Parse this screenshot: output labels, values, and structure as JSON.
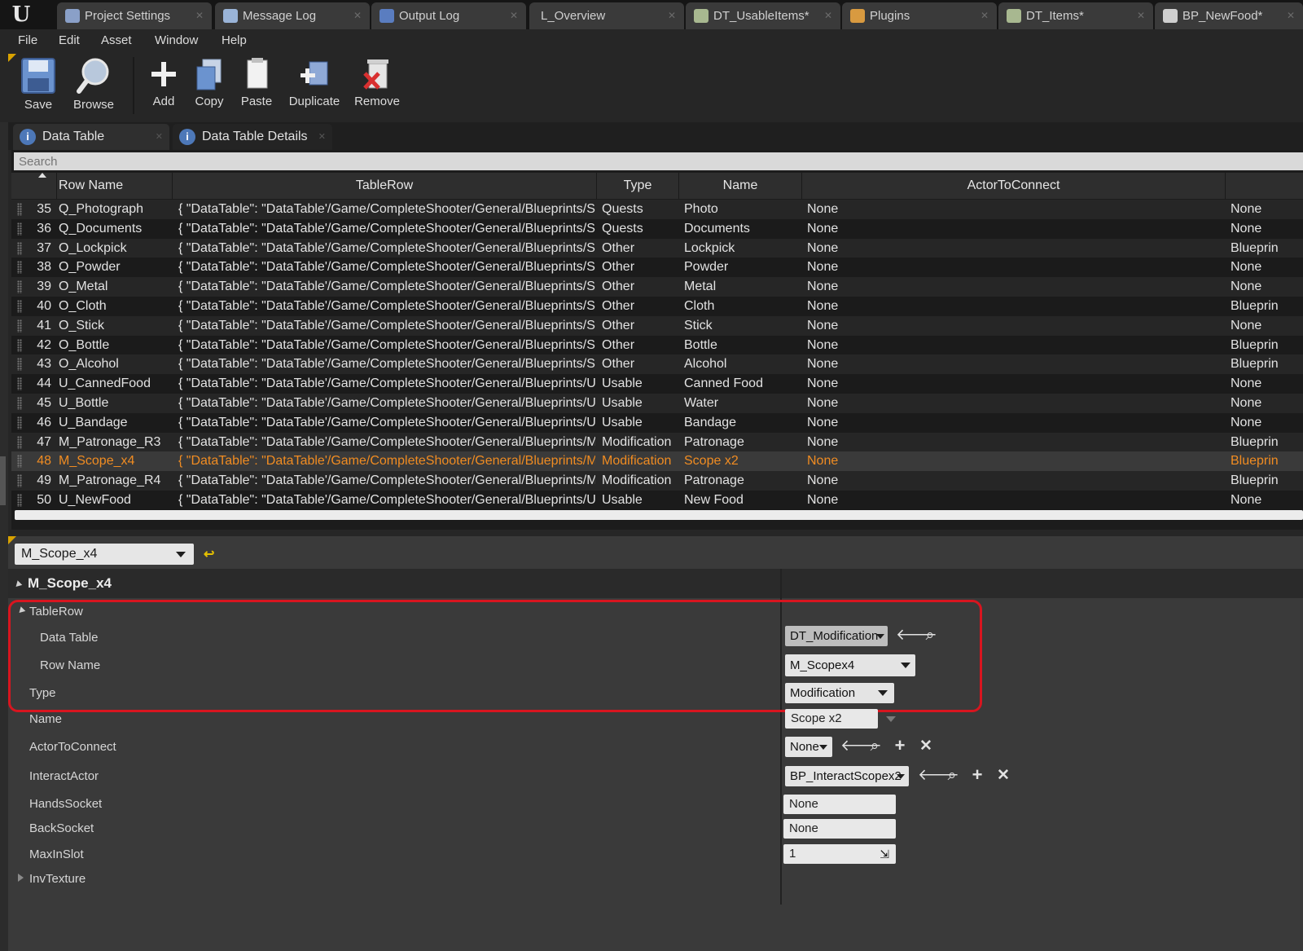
{
  "tabs": [
    {
      "label": "Project Settings",
      "icon": "gear-icon",
      "color": "#8aa0c8"
    },
    {
      "label": "Message Log",
      "icon": "message-log-icon",
      "color": "#9ab4d8"
    },
    {
      "label": "Output Log",
      "icon": "output-log-icon",
      "color": "#5a7dc0"
    },
    {
      "label": "L_Overview",
      "icon": "",
      "color": ""
    },
    {
      "label": "DT_UsableItems*",
      "icon": "data-table-icon",
      "color": "#a8b890"
    },
    {
      "label": "Plugins",
      "icon": "plugin-icon",
      "color": "#d89a40"
    },
    {
      "label": "DT_Items*",
      "icon": "data-table-icon",
      "color": "#a8b890"
    },
    {
      "label": "BP_NewFood*",
      "icon": "blueprint-icon",
      "color": "#cfcfcf"
    }
  ],
  "menu": [
    "File",
    "Edit",
    "Asset",
    "Window",
    "Help"
  ],
  "toolbar": {
    "save": "Save",
    "browse": "Browse",
    "add": "Add",
    "copy": "Copy",
    "paste": "Paste",
    "duplicate": "Duplicate",
    "remove": "Remove"
  },
  "panel_tabs": {
    "data_table": "Data Table",
    "details": "Data Table Details"
  },
  "search": {
    "placeholder": "Search"
  },
  "table": {
    "columns": [
      "Row Name",
      "TableRow",
      "Type",
      "Name",
      "ActorToConnect"
    ],
    "rows": [
      {
        "num": "35",
        "row_name": "Q_Photograph",
        "table_row": "{ \"DataTable\": \"DataTable'/Game/CompleteShooter/General/Blueprints/S",
        "type": "Quests",
        "name": "Photo",
        "actor": "None",
        "extra": "None"
      },
      {
        "num": "36",
        "row_name": "Q_Documents",
        "table_row": "{ \"DataTable\": \"DataTable'/Game/CompleteShooter/General/Blueprints/S",
        "type": "Quests",
        "name": "Documents",
        "actor": "None",
        "extra": "None"
      },
      {
        "num": "37",
        "row_name": "O_Lockpick",
        "table_row": "{ \"DataTable\": \"DataTable'/Game/CompleteShooter/General/Blueprints/S",
        "type": "Other",
        "name": "Lockpick",
        "actor": "None",
        "extra": "Blueprin"
      },
      {
        "num": "38",
        "row_name": "O_Powder",
        "table_row": "{ \"DataTable\": \"DataTable'/Game/CompleteShooter/General/Blueprints/S",
        "type": "Other",
        "name": "Powder",
        "actor": "None",
        "extra": "None"
      },
      {
        "num": "39",
        "row_name": "O_Metal",
        "table_row": "{ \"DataTable\": \"DataTable'/Game/CompleteShooter/General/Blueprints/S",
        "type": "Other",
        "name": "Metal",
        "actor": "None",
        "extra": "None"
      },
      {
        "num": "40",
        "row_name": "O_Cloth",
        "table_row": "{ \"DataTable\": \"DataTable'/Game/CompleteShooter/General/Blueprints/S",
        "type": "Other",
        "name": "Cloth",
        "actor": "None",
        "extra": "Blueprin"
      },
      {
        "num": "41",
        "row_name": "O_Stick",
        "table_row": "{ \"DataTable\": \"DataTable'/Game/CompleteShooter/General/Blueprints/S",
        "type": "Other",
        "name": "Stick",
        "actor": "None",
        "extra": "None"
      },
      {
        "num": "42",
        "row_name": "O_Bottle",
        "table_row": "{ \"DataTable\": \"DataTable'/Game/CompleteShooter/General/Blueprints/S",
        "type": "Other",
        "name": "Bottle",
        "actor": "None",
        "extra": "Blueprin"
      },
      {
        "num": "43",
        "row_name": "O_Alcohol",
        "table_row": "{ \"DataTable\": \"DataTable'/Game/CompleteShooter/General/Blueprints/S",
        "type": "Other",
        "name": "Alcohol",
        "actor": "None",
        "extra": "Blueprin"
      },
      {
        "num": "44",
        "row_name": "U_CannedFood",
        "table_row": "{ \"DataTable\": \"DataTable'/Game/CompleteShooter/General/Blueprints/U",
        "type": "Usable",
        "name": "Canned Food",
        "actor": "None",
        "extra": "None"
      },
      {
        "num": "45",
        "row_name": "U_Bottle",
        "table_row": "{ \"DataTable\": \"DataTable'/Game/CompleteShooter/General/Blueprints/U",
        "type": "Usable",
        "name": "Water",
        "actor": "None",
        "extra": "None"
      },
      {
        "num": "46",
        "row_name": "U_Bandage",
        "table_row": "{ \"DataTable\": \"DataTable'/Game/CompleteShooter/General/Blueprints/U",
        "type": "Usable",
        "name": "Bandage",
        "actor": "None",
        "extra": "None"
      },
      {
        "num": "47",
        "row_name": "M_Patronage_R3",
        "table_row": "{ \"DataTable\": \"DataTable'/Game/CompleteShooter/General/Blueprints/M",
        "type": "Modification",
        "name": "Patronage",
        "actor": "None",
        "extra": "Blueprin"
      },
      {
        "num": "48",
        "row_name": "M_Scope_x4",
        "table_row": "{ \"DataTable\": \"DataTable'/Game/CompleteShooter/General/Blueprints/M",
        "type": "Modification",
        "name": "Scope x2",
        "actor": "None",
        "extra": "Blueprin",
        "selected": true
      },
      {
        "num": "49",
        "row_name": "M_Patronage_R4",
        "table_row": "{ \"DataTable\": \"DataTable'/Game/CompleteShooter/General/Blueprints/M",
        "type": "Modification",
        "name": "Patronage",
        "actor": "None",
        "extra": "Blueprin"
      },
      {
        "num": "50",
        "row_name": "U_NewFood",
        "table_row": "{ \"DataTable\": \"DataTable'/Game/CompleteShooter/General/Blueprints/U",
        "type": "Usable",
        "name": "New Food",
        "actor": "None",
        "extra": "None"
      }
    ]
  },
  "details": {
    "row_select": "M_Scope_x4",
    "category": "M_Scope_x4",
    "props": {
      "table_row": "TableRow",
      "data_table_label": "Data Table",
      "data_table_value": "DT_Modification",
      "row_name_label": "Row Name",
      "row_name_value": "M_Scopex4",
      "type_label": "Type",
      "type_value": "Modification",
      "name_label": "Name",
      "name_value": "Scope x2",
      "actor_label": "ActorToConnect",
      "actor_value": "None",
      "interact_label": "InteractActor",
      "interact_value": "BP_InteractScopex2",
      "hands_label": "HandsSocket",
      "hands_value": "None",
      "back_label": "BackSocket",
      "back_value": "None",
      "max_label": "MaxInSlot",
      "max_value": "1",
      "inv_label": "InvTexture"
    }
  },
  "colors": {
    "selected_row": "#f08c22",
    "highlight_box": "#d8151f",
    "accent_corner": "#d8a200"
  }
}
